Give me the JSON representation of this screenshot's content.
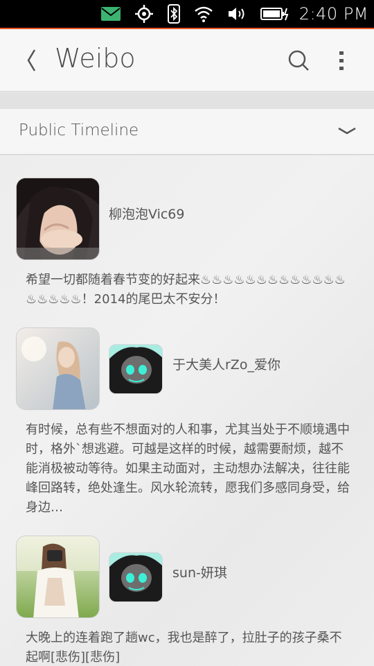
{
  "status_bar": {
    "time": "2:40 PM",
    "icons": [
      "mail-icon",
      "location-icon",
      "bluetooth-icon",
      "wifi-icon",
      "volume-icon",
      "battery-charging-icon"
    ],
    "mail_color": "#3cb371",
    "accent": "#e95420"
  },
  "header": {
    "title": "Weibo",
    "back_icon": "chevron-left-icon",
    "search_icon": "search-icon",
    "menu_icon": "overflow-menu-icon"
  },
  "section": {
    "label": "Public Timeline",
    "dropdown_icon": "chevron-down-icon"
  },
  "posts": [
    {
      "username": "柳泡泡Vic69",
      "text": "希望一切都随着春节变的好起来♨♨♨♨♨♨♨♨♨♨♨♨♨♨♨♨♨♨！2014的尾巴太不安分！",
      "has_retweet_avatar": false
    },
    {
      "username": "于大美人rZo_爱你",
      "text": "有时候，总有些不想面对的人和事，尤其当处于不顺境遇中时，格外`想逃避。可越是这样的时候，越需要耐烦，越不能消极被动等待。如果主动面对，主动想办法解决，往往能峰回路转，绝处逢生。风水轮流转，愿我们多感同身受，给身边…",
      "has_retweet_avatar": true
    },
    {
      "username": "sun-妍琪",
      "text": "大晚上的连着跑了趟wc，我也是醉了，拉肚子的孩子桑不起啊[悲伤][悲伤]",
      "has_retweet_avatar": true
    }
  ]
}
